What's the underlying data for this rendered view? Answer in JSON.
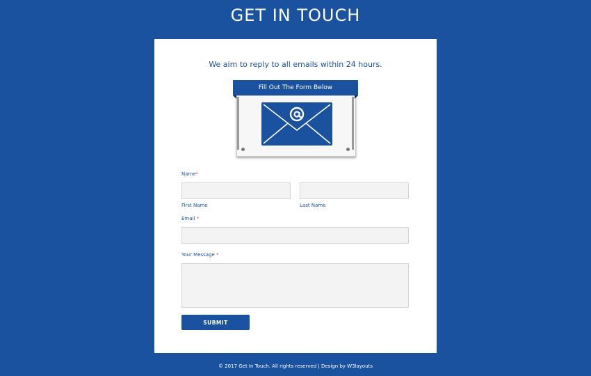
{
  "header": {
    "title": "GET IN TOUCH"
  },
  "card": {
    "tagline": "We aim to reply to all emails within 24 hours.",
    "banner_label": "Fill Out The Form Below"
  },
  "form": {
    "name_label": "Name",
    "required_mark": "*",
    "first_name_caption": "First Name",
    "last_name_caption": "Last Name",
    "email_label": "Email ",
    "message_label": "Your Message ",
    "first_name_value": "",
    "last_name_value": "",
    "email_value": "",
    "message_value": "",
    "submit_label": "SUBMIT"
  },
  "footer": {
    "text": "© 2017 Get In Touch. All rights reserved | Design by W3layouts"
  },
  "colors": {
    "background": "#1a52a0",
    "card": "#ffffff",
    "accent": "#1a52a0",
    "required": "#e0453d",
    "field_bg": "#f3f3f3"
  },
  "icons": {
    "envelope": "envelope-icon",
    "at_sign": "at-sign-icon"
  }
}
